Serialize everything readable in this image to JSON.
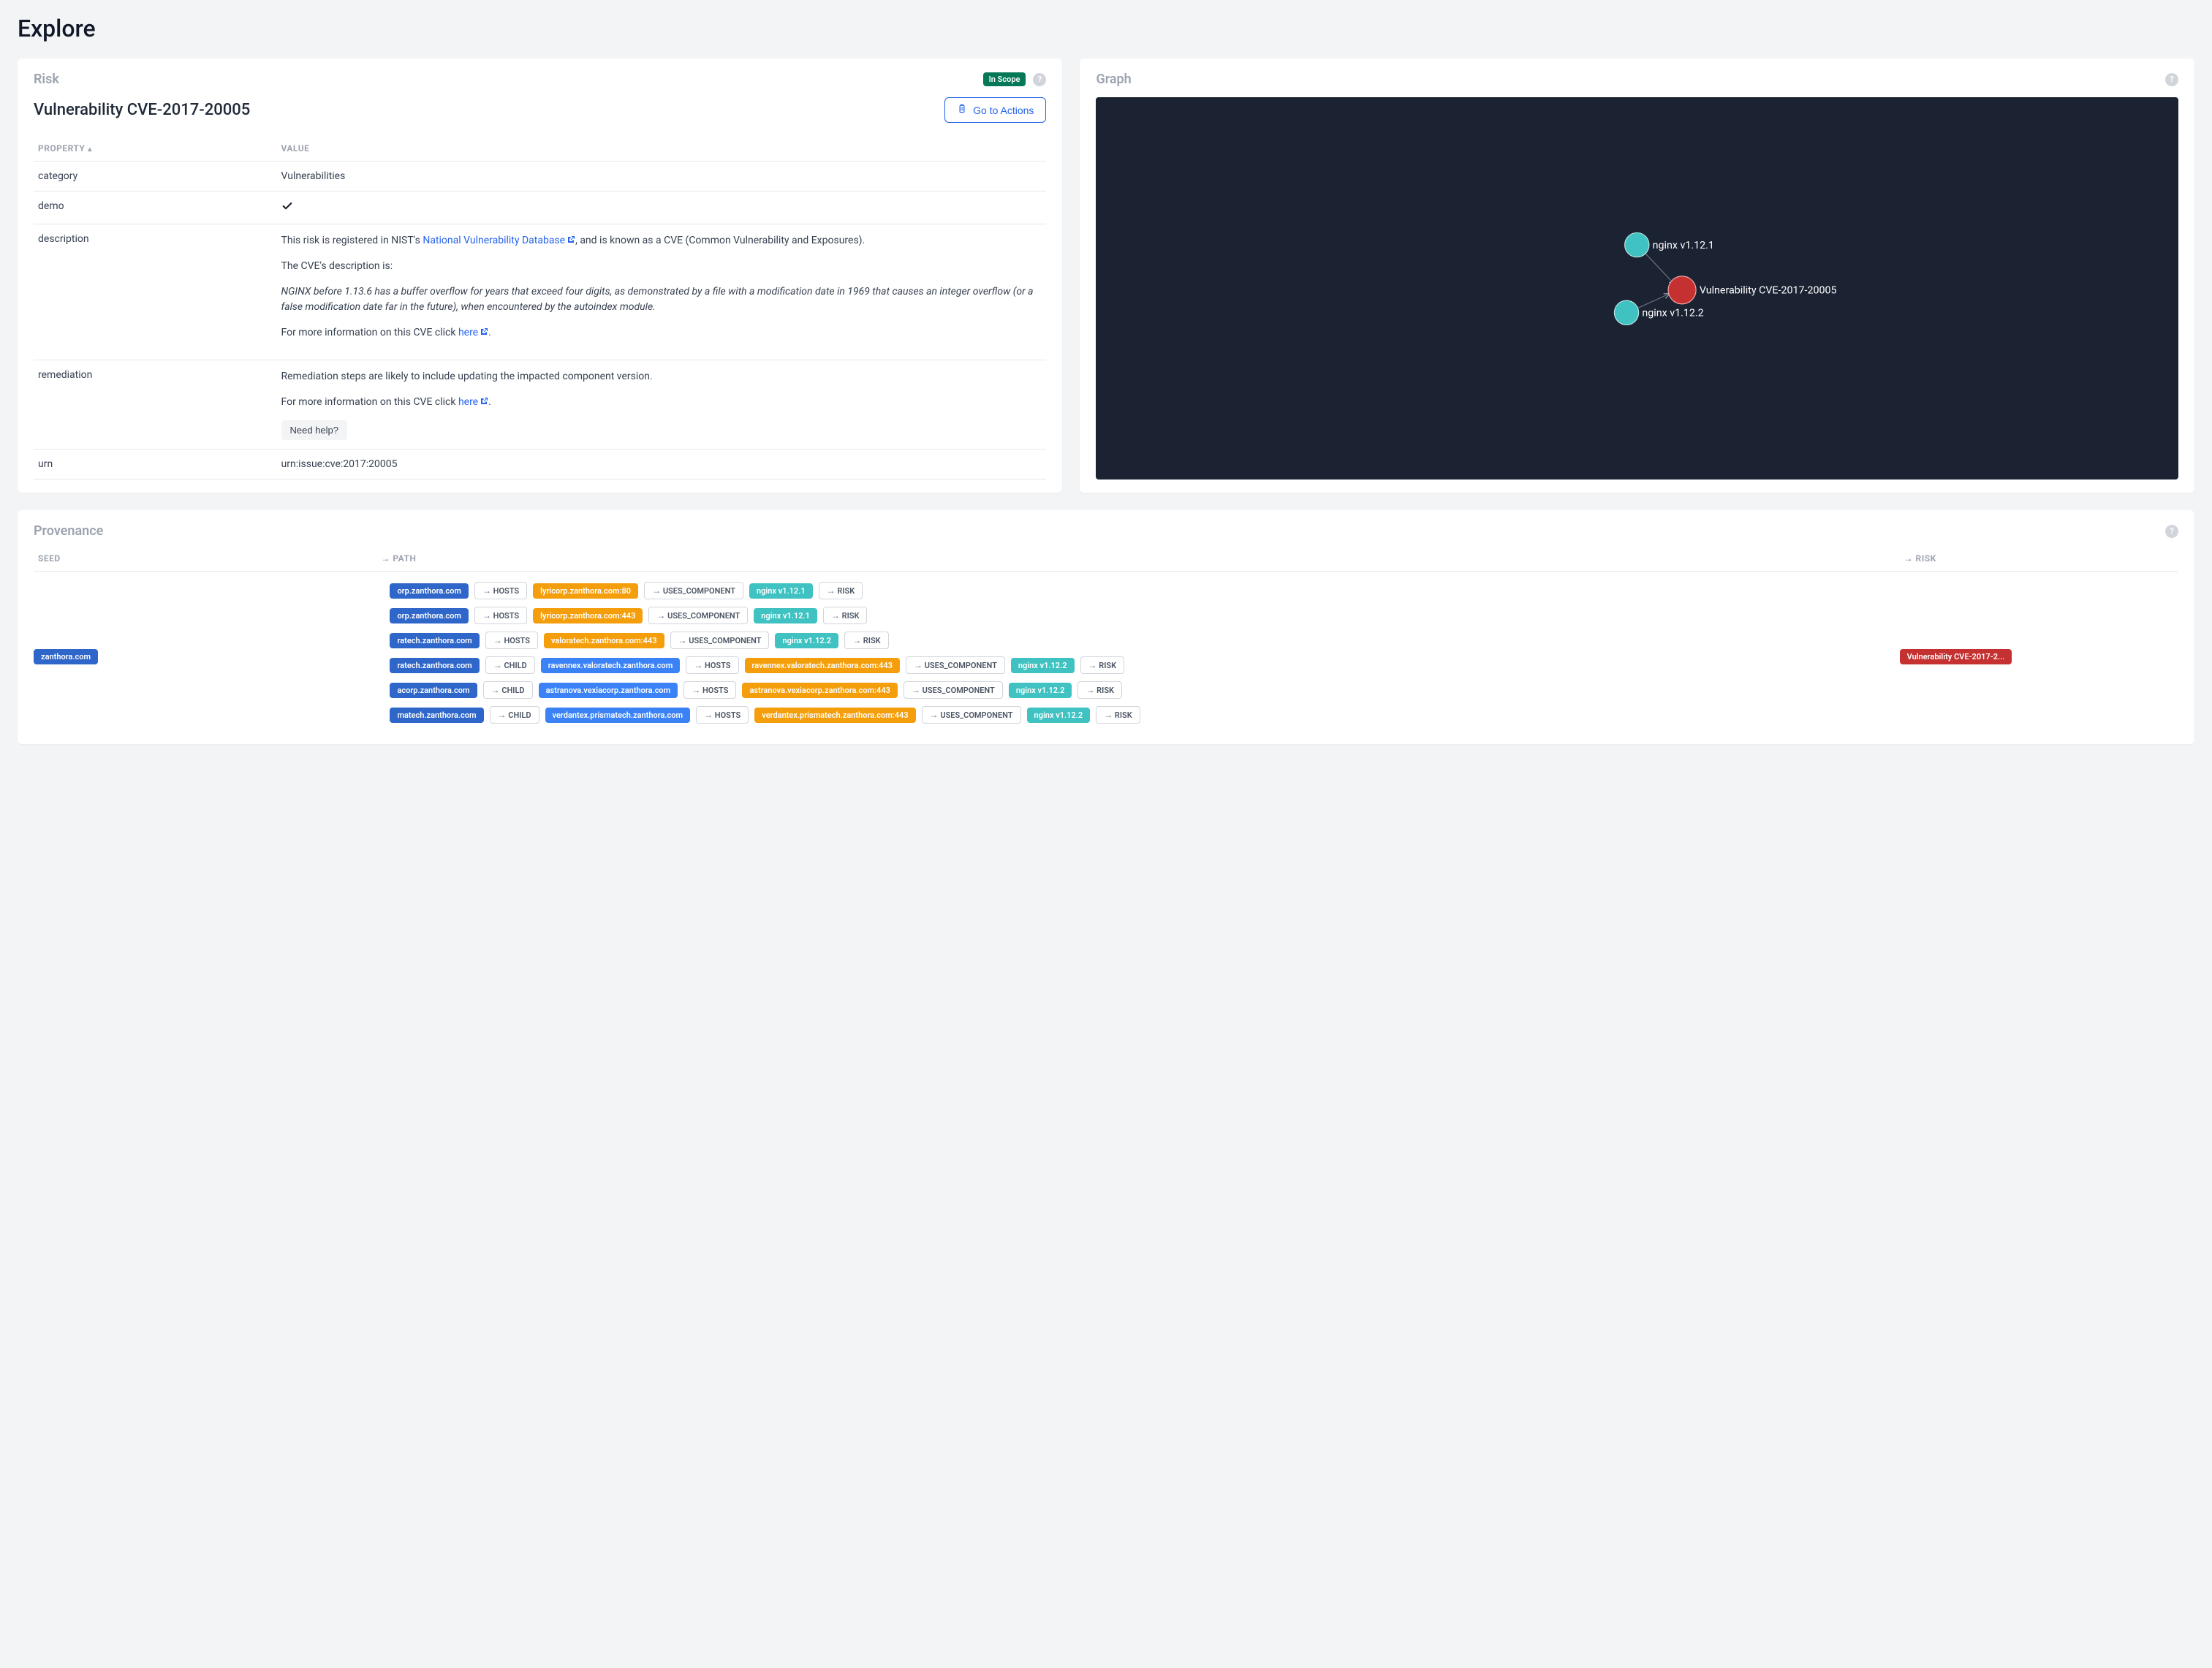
{
  "page": {
    "title": "Explore"
  },
  "risk_card": {
    "title": "Risk",
    "scope_badge": "In Scope",
    "risk_name": "Vulnerability CVE-2017-20005",
    "action_button": "Go to Actions",
    "table": {
      "col_property": "PROPERTY",
      "col_value": "VALUE",
      "rows": {
        "category": {
          "key": "category",
          "value": "Vulnerabilities"
        },
        "demo": {
          "key": "demo",
          "checked": true
        },
        "description": {
          "key": "description",
          "intro_pre": "This risk is registered in NIST's ",
          "intro_link": "National Vulnerability Database",
          "intro_post": ", and is known as a CVE (Common Vulnerability and Exposures).",
          "desc_label": "The CVE's description is:",
          "cve_text": "NGINX before 1.13.6 has a buffer overflow for years that exceed four digits, as demonstrated by a file with a modification date in 1969 that causes an integer overflow (or a false modification date far in the future), when encountered by the autoindex module.",
          "more_pre": "For more information on this CVE click ",
          "more_link": "here",
          "more_post": "."
        },
        "remediation": {
          "key": "remediation",
          "text": "Remediation steps are likely to include updating the impacted component version.",
          "more_pre": "For more information on this CVE click ",
          "more_link": "here",
          "more_post": ".",
          "help_btn": "Need help?"
        },
        "urn": {
          "key": "urn",
          "value": "urn:issue:cve:2017:20005"
        }
      }
    }
  },
  "graph_card": {
    "title": "Graph",
    "nodes": {
      "n1": "nginx v1.12.1",
      "n2": "nginx v1.12.2",
      "n3": "Vulnerability CVE-2017-20005"
    }
  },
  "provenance_card": {
    "title": "Provenance",
    "cols": {
      "seed": "SEED",
      "path": "PATH",
      "risk": "RISK"
    },
    "arrow": "→",
    "rel": {
      "hosts": "HOSTS",
      "uses": "USES_COMPONENT",
      "child": "CHILD",
      "risk": "RISK"
    },
    "seed_chip": "zanthora.com",
    "risk_chip": "Vulnerability CVE-2017-2...",
    "paths": [
      {
        "a": "orp.zanthora.com",
        "r1": "HOSTS",
        "b": "lyricorp.zanthora.com:80",
        "r2": "USES_COMPONENT",
        "c": "nginx v1.12.1",
        "r3": "RISK"
      },
      {
        "a": "orp.zanthora.com",
        "r1": "HOSTS",
        "b": "lyricorp.zanthora.com:443",
        "r2": "USES_COMPONENT",
        "c": "nginx v1.12.1",
        "r3": "RISK"
      },
      {
        "a": "ratech.zanthora.com",
        "r1": "HOSTS",
        "b": "valoratech.zanthora.com:443",
        "r2": "USES_COMPONENT",
        "c": "nginx v1.12.2",
        "r3": "RISK"
      },
      {
        "a": "ratech.zanthora.com",
        "r1": "CHILD",
        "b": "ravennex.valoratech.zanthora.com",
        "r2": "HOSTS",
        "c": "ravennex.valoratech.zanthora.com:443",
        "r3": "USES_COMPONENT",
        "d": "nginx v1.12.2",
        "r4": "RISK"
      },
      {
        "a": "acorp.zanthora.com",
        "r1": "CHILD",
        "b": "astranova.vexiacorp.zanthora.com",
        "r2": "HOSTS",
        "c": "astranova.vexiacorp.zanthora.com:443",
        "r3": "USES_COMPONENT",
        "d": "nginx v1.12.2",
        "r4": "RISK"
      },
      {
        "a": "matech.zanthora.com",
        "r1": "CHILD",
        "b": "verdantex.prismatech.zanthora.com",
        "r2": "HOSTS",
        "c": "verdantex.prismatech.zanthora.com:443",
        "r3": "USES_COMPONENT",
        "d": "nginx v1.12.2",
        "r4": "RISK"
      }
    ]
  }
}
